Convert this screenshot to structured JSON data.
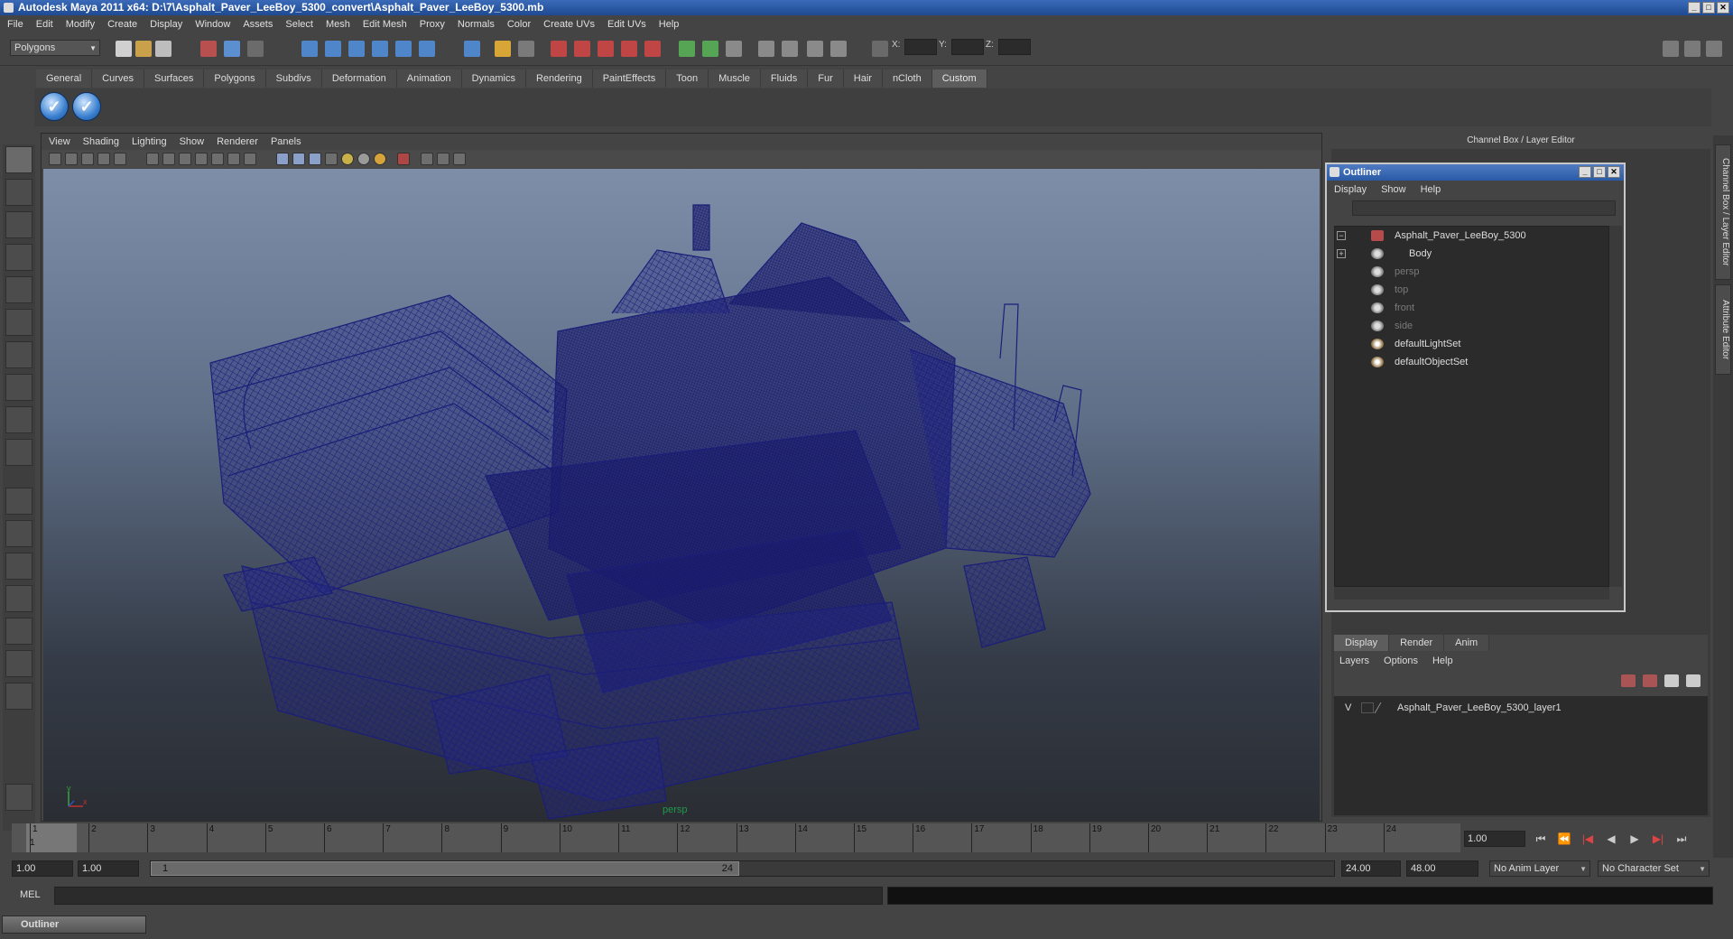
{
  "window": {
    "title": "Autodesk Maya 2011 x64: D:\\7\\Asphalt_Paver_LeeBoy_5300_convert\\Asphalt_Paver_LeeBoy_5300.mb",
    "min": "_",
    "max": "□",
    "close": "✕"
  },
  "menubar": [
    "File",
    "Edit",
    "Modify",
    "Create",
    "Display",
    "Window",
    "Assets",
    "Select",
    "Mesh",
    "Edit Mesh",
    "Proxy",
    "Normals",
    "Color",
    "Create UVs",
    "Edit UVs",
    "Help"
  ],
  "statusline": {
    "mode": "Polygons",
    "x_label": "X:",
    "y_label": "Y:",
    "z_label": "Z:"
  },
  "shelf": {
    "tabs": [
      "General",
      "Curves",
      "Surfaces",
      "Polygons",
      "Subdivs",
      "Deformation",
      "Animation",
      "Dynamics",
      "Rendering",
      "PaintEffects",
      "Toon",
      "Muscle",
      "Fluids",
      "Fur",
      "Hair",
      "nCloth",
      "Custom"
    ],
    "active_tab": "Custom",
    "button_glyph": "✓"
  },
  "viewport": {
    "menu": [
      "View",
      "Shading",
      "Lighting",
      "Show",
      "Renderer",
      "Panels"
    ],
    "camera_label": "persp",
    "axis_x": "x",
    "axis_y": "y",
    "wire_color": "#1b1e78"
  },
  "channel_box": {
    "header": "Channel Box / Layer Editor"
  },
  "side_tabs": [
    "Channel Box / Layer Editor",
    "Attribute Editor"
  ],
  "outliner": {
    "title": "Outliner",
    "menu": [
      "Display",
      "Show",
      "Help"
    ],
    "items": [
      {
        "label": "Asphalt_Paver_LeeBoy_5300",
        "expander": "−",
        "dim": false
      },
      {
        "label": "Body",
        "expander": "+",
        "dim": false
      },
      {
        "label": "persp",
        "expander": "",
        "dim": true
      },
      {
        "label": "top",
        "expander": "",
        "dim": true
      },
      {
        "label": "front",
        "expander": "",
        "dim": true
      },
      {
        "label": "side",
        "expander": "",
        "dim": true
      },
      {
        "label": "defaultLightSet",
        "expander": "",
        "dim": false
      },
      {
        "label": "defaultObjectSet",
        "expander": "",
        "dim": false
      }
    ]
  },
  "layer_editor": {
    "tabs": [
      "Display",
      "Render",
      "Anim"
    ],
    "active_tab": "Display",
    "menu": [
      "Layers",
      "Options",
      "Help"
    ],
    "layer_visibility": "V",
    "layer_name": "Asphalt_Paver_LeeBoy_5300_layer1"
  },
  "timeline": {
    "ticks": [
      "1",
      "2",
      "3",
      "4",
      "5",
      "6",
      "7",
      "8",
      "9",
      "10",
      "11",
      "12",
      "13",
      "14",
      "15",
      "16",
      "17",
      "18",
      "19",
      "20",
      "21",
      "22",
      "23",
      "24"
    ],
    "current_frame": "1.00",
    "current_marker": "1",
    "playback": [
      "⏮",
      "⏪",
      "|◀",
      "◀",
      "▶",
      "▶|",
      "⏭"
    ]
  },
  "range": {
    "start": "1.00",
    "playback_start": "1.00",
    "slider_start": "1",
    "slider_end": "24",
    "playback_end": "24.00",
    "end": "48.00",
    "anim_layer": "No Anim Layer",
    "character_set": "No Character Set"
  },
  "command": {
    "label": "MEL"
  },
  "taskbar": {
    "outliner_label": "Outliner"
  }
}
